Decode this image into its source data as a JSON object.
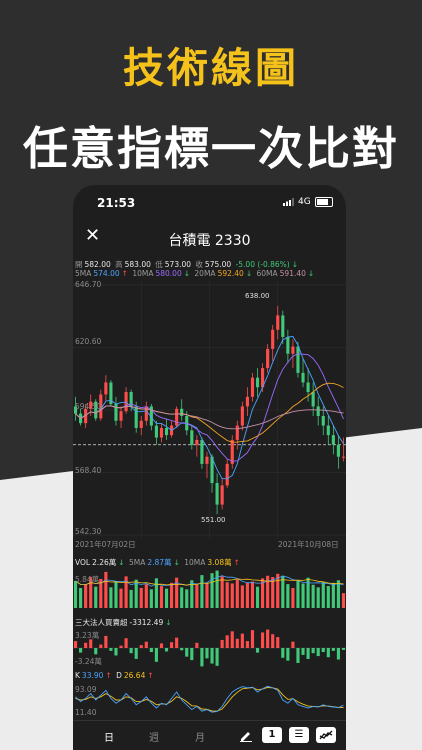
{
  "headline": {
    "title": "技術線圖",
    "subtitle": "任意指標一次比對"
  },
  "colors": {
    "accent_yellow": "#f5c21b",
    "up_red": "#ff4d4d",
    "down_green": "#3fc978",
    "ma5": "#4aa3ff",
    "ma10": "#9b6bff",
    "ma20": "#f5a623",
    "ma60": "#c58fa8"
  },
  "status_bar": {
    "time": "21:53",
    "network": "4G"
  },
  "nav": {
    "close_icon": "close-icon",
    "title": "台積電 2330"
  },
  "quote": {
    "open_label": "開",
    "open": "582.00",
    "high_label": "高",
    "high": "583.00",
    "low_label": "低",
    "low": "573.00",
    "close_label": "收",
    "close": "575.00",
    "change": "-5.00 (-0.86%)",
    "change_arrow": "↓"
  },
  "ma": {
    "ma5_label": "5MA",
    "ma5": "574.00",
    "ma5_arrow": "↑",
    "ma10_label": "10MA",
    "ma10": "580.00",
    "ma10_arrow": "↓",
    "ma20_label": "20MA",
    "ma20": "592.40",
    "ma20_arrow": "↓",
    "ma60_label": "60MA",
    "ma60": "591.40",
    "ma60_arrow": "↓"
  },
  "price_chart": {
    "y_ticks": [
      "646.70",
      "620.60",
      "594.50",
      "568.40",
      "542.30"
    ],
    "max_label": "638.00",
    "min_label": "551.00",
    "start_date": "2021年07月02日",
    "end_date": "2021年10月08日"
  },
  "volume": {
    "label": "VOL",
    "vol": "2.26萬",
    "vol_arrow": "↓",
    "ma5_label": "5MA",
    "ma5": "2.87萬",
    "ma5_arrow": "↓",
    "ma10_label": "10MA",
    "ma10": "3.08萬",
    "ma10_arrow": "↑",
    "y_tick": "5.84萬"
  },
  "institutional": {
    "label": "三大法人買賣超",
    "value": "-3312.49",
    "arrow": "↓",
    "y_top": "3.23萬",
    "y_bottom": "-3.24萬"
  },
  "kd": {
    "k_label": "K",
    "k": "33.90",
    "k_arrow": "↑",
    "d_label": "D",
    "d": "26.64",
    "d_arrow": "↑",
    "y_top": "93.09",
    "y_bottom": "11.40"
  },
  "tabs": {
    "day": "日",
    "week": "週",
    "month": "月",
    "count": "1"
  },
  "chart_data": {
    "type": "candlestick",
    "ylim": [
      542.3,
      646.7
    ],
    "high_marker": 638.0,
    "low_marker": 551.0,
    "reference_price": 580.0,
    "ohlc": [
      [
        596,
        600,
        590,
        593
      ],
      [
        593,
        595,
        588,
        589
      ],
      [
        589,
        597,
        587,
        595
      ],
      [
        595,
        601,
        592,
        598
      ],
      [
        598,
        599,
        590,
        591
      ],
      [
        591,
        603,
        590,
        601
      ],
      [
        601,
        609,
        598,
        606
      ],
      [
        606,
        607,
        596,
        597
      ],
      [
        597,
        600,
        588,
        590
      ],
      [
        590,
        596,
        587,
        594
      ],
      [
        594,
        604,
        593,
        602
      ],
      [
        602,
        603,
        594,
        596
      ],
      [
        596,
        598,
        585,
        587
      ],
      [
        587,
        592,
        584,
        590
      ],
      [
        590,
        598,
        588,
        596
      ],
      [
        596,
        597,
        586,
        588
      ],
      [
        588,
        590,
        580,
        583
      ],
      [
        583,
        589,
        581,
        587
      ],
      [
        587,
        591,
        582,
        584
      ],
      [
        584,
        590,
        583,
        588
      ],
      [
        588,
        596,
        587,
        595
      ],
      [
        595,
        599,
        590,
        592
      ],
      [
        592,
        594,
        584,
        586
      ],
      [
        586,
        588,
        578,
        580
      ],
      [
        580,
        584,
        575,
        582
      ],
      [
        582,
        583,
        570,
        572
      ],
      [
        572,
        577,
        566,
        575
      ],
      [
        575,
        576,
        560,
        564
      ],
      [
        564,
        568,
        551,
        555
      ],
      [
        555,
        566,
        553,
        563
      ],
      [
        563,
        574,
        562,
        572
      ],
      [
        572,
        584,
        570,
        582
      ],
      [
        582,
        590,
        578,
        588
      ],
      [
        588,
        598,
        586,
        596
      ],
      [
        596,
        604,
        592,
        600
      ],
      [
        600,
        610,
        598,
        608
      ],
      [
        608,
        612,
        600,
        604
      ],
      [
        604,
        614,
        602,
        612
      ],
      [
        612,
        622,
        610,
        620
      ],
      [
        620,
        630,
        615,
        628
      ],
      [
        628,
        638,
        624,
        634
      ],
      [
        634,
        636,
        622,
        625
      ],
      [
        625,
        628,
        614,
        618
      ],
      [
        618,
        624,
        612,
        621
      ],
      [
        621,
        623,
        608,
        610
      ],
      [
        610,
        616,
        604,
        606
      ],
      [
        606,
        612,
        598,
        602
      ],
      [
        602,
        606,
        592,
        596
      ],
      [
        596,
        600,
        588,
        592
      ],
      [
        592,
        596,
        584,
        588
      ],
      [
        588,
        592,
        580,
        584
      ],
      [
        584,
        588,
        576,
        580
      ],
      [
        580,
        584,
        570,
        575
      ],
      [
        575,
        583,
        573,
        575
      ]
    ],
    "ma_series": [
      {
        "name": "5MA",
        "color": "#4aa3ff"
      },
      {
        "name": "10MA",
        "color": "#9b6bff"
      },
      {
        "name": "20MA",
        "color": "#f5a623"
      },
      {
        "name": "60MA",
        "color": "#c58fa8"
      }
    ],
    "volume": [
      4.2,
      3.1,
      3.6,
      4.8,
      3.3,
      4.5,
      5.6,
      3.2,
      4.1,
      3.0,
      4.9,
      2.8,
      4.4,
      3.1,
      3.7,
      2.9,
      4.6,
      3.4,
      3.0,
      3.9,
      4.7,
      3.2,
      2.9,
      4.3,
      3.6,
      5.1,
      3.8,
      5.4,
      5.8,
      4.9,
      4.0,
      3.8,
      4.4,
      3.5,
      3.9,
      4.1,
      3.3,
      4.6,
      5.0,
      4.8,
      5.3,
      5.0,
      3.7,
      3.1,
      4.2,
      3.8,
      4.7,
      3.6,
      3.2,
      4.0,
      3.4,
      3.9,
      4.3,
      2.3
    ],
    "institutional_net": [
      1.2,
      -0.8,
      0.9,
      1.5,
      -1.1,
      0.6,
      2.1,
      -0.5,
      -1.3,
      0.4,
      1.7,
      -0.9,
      -1.9,
      0.5,
      1.1,
      -0.7,
      -2.4,
      0.8,
      -0.6,
      1.0,
      1.8,
      -0.4,
      -1.5,
      -2.1,
      0.9,
      -3.2,
      -1.8,
      -2.7,
      -3.1,
      1.4,
      2.2,
      2.9,
      1.6,
      2.5,
      1.2,
      3.1,
      -0.8,
      2.7,
      3.2,
      2.4,
      1.9,
      -1.7,
      -2.2,
      1.1,
      -2.6,
      -1.2,
      -1.9,
      -0.9,
      -1.4,
      -0.7,
      -1.6,
      -0.5,
      -2.0,
      -0.33
    ],
    "kd_k": [
      60,
      45,
      55,
      70,
      50,
      65,
      80,
      55,
      40,
      50,
      70,
      55,
      35,
      45,
      60,
      40,
      25,
      40,
      35,
      55,
      75,
      50,
      35,
      20,
      30,
      15,
      20,
      12,
      14,
      30,
      55,
      75,
      85,
      92,
      88,
      90,
      75,
      85,
      93,
      88,
      80,
      50,
      40,
      55,
      35,
      30,
      25,
      30,
      28,
      35,
      30,
      28,
      26,
      34
    ],
    "kd_d": [
      55,
      50,
      52,
      60,
      55,
      60,
      70,
      62,
      50,
      50,
      60,
      57,
      45,
      45,
      52,
      46,
      35,
      38,
      37,
      46,
      60,
      55,
      45,
      32,
      31,
      22,
      21,
      16,
      15,
      22,
      40,
      60,
      74,
      85,
      87,
      89,
      82,
      84,
      89,
      88,
      84,
      66,
      52,
      54,
      44,
      37,
      31,
      30,
      29,
      32,
      31,
      29,
      27,
      26.6
    ]
  }
}
